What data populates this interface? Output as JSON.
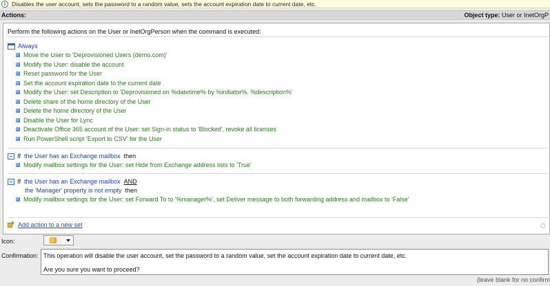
{
  "info_bar": {
    "text": "Disables the user account, sets the password to a random value, sets the account expiration date to current date, etc."
  },
  "header": {
    "actions_label": "Actions:",
    "object_type_label": "Object type:",
    "object_type_value": "User or InetOrgP"
  },
  "intro": "Perform the following actions on the User or InetOrgPerson when the command is executed:",
  "always_set": {
    "label": "Always",
    "actions": [
      "Move the User to 'Deprovisioned Users (demo.com)'",
      "Modify the User: disable the account",
      "Reset password for the User",
      "Set the account expiration date to the current date",
      "Modify the User: set Description to 'Deprovisioned on %datetime% by %initiator%. %description%'",
      "Delete share of the home directory of the User",
      "Delete the home directory of the User",
      "Disable the User for Lync",
      "Deactivate Office 365 account of the User: set Sign-in status to 'Blocked', revoke all licenses",
      "Run PowerShell script 'Export to CSV' for the User"
    ]
  },
  "cond1": {
    "if": "If",
    "cond": "the User has an Exchange mailbox",
    "then": "then",
    "action": "Modify mailbox settings for the User: set Hide from Exchange address lists to 'True'"
  },
  "cond2": {
    "if": "If",
    "cond": "the User has an Exchange mailbox",
    "and": "AND",
    "cond_b": "the 'Manager' property is not empty",
    "then": "then",
    "action": "Modify mailbox settings for the User: set Forward To to '%manager%', set Deliver message to both forwarding address and mailbox to 'False'"
  },
  "add_action": "Add action to a new set",
  "icon_label": "Icon:",
  "confirmation_label": "Confirmation:",
  "confirmation": {
    "line1": "This operation will disable the user account, set the password to a random value, set the account expiration date to current date, etc.",
    "line2": "Are you sure you want to proceed?"
  },
  "hint": "(leave blank for no confirm"
}
